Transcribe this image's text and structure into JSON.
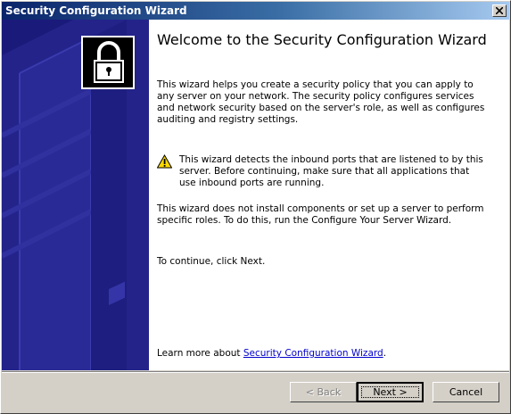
{
  "window": {
    "title": "Security Configuration Wizard"
  },
  "main": {
    "heading": "Welcome to the Security Configuration Wizard",
    "paragraph1": "This wizard helps you create a security policy that you can apply to any server on your network. The security policy configures services and network security based on the server's role, as well as configures auditing and registry settings.",
    "warning_text": "This wizard detects the inbound ports that are listened to by this server. Before continuing, make sure that all applications that use inbound ports are running.",
    "paragraph3": "This wizard does not install components or set up a server to perform specific roles. To do this, run the Configure Your Server Wizard.",
    "continue_text": "To continue, click Next.",
    "learn_more_prefix": "Learn more about ",
    "learn_more_link": "Security Configuration Wizard",
    "learn_more_suffix": "."
  },
  "buttons": {
    "back": "< Back",
    "next": "Next >",
    "cancel": "Cancel"
  },
  "icons": {
    "banner": "padlock-icon",
    "warning": "warning-icon",
    "close": "close-icon"
  },
  "colors": {
    "titlebar_start": "#0a246a",
    "banner_bg": "#1a1a7a",
    "link": "#0000cc"
  }
}
